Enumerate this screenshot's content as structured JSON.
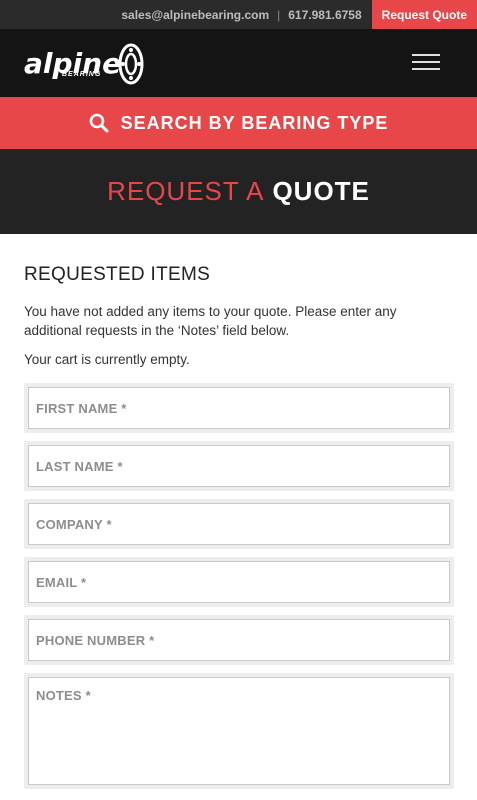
{
  "topbar": {
    "email": "sales@alpinebearing.com",
    "separator": "|",
    "phone": "617.981.6758",
    "request_quote_label": "Request Quote"
  },
  "header": {
    "logo_word": "alpine",
    "logo_sub": "BEARING",
    "menu_icon": "hamburger-icon"
  },
  "search_banner": {
    "icon": "search-icon",
    "label": "SEARCH BY BEARING TYPE"
  },
  "title": {
    "part1": "REQUEST A",
    "part2": "QUOTE"
  },
  "main": {
    "heading": "REQUESTED ITEMS",
    "notice": "You have not added any items to your quote. Please enter any additional requests in the ‘Notes’ field below.",
    "cart_status": "Your cart is currently empty."
  },
  "form": {
    "first_name_placeholder": "FIRST NAME *",
    "last_name_placeholder": "LAST NAME *",
    "company_placeholder": "COMPANY *",
    "email_placeholder": "EMAIL *",
    "phone_placeholder": "PHONE NUMBER *",
    "notes_placeholder": "NOTES *"
  },
  "colors": {
    "accent": "#e8474a",
    "topbar_bg": "#2b2b2b",
    "header_bg": "#141414",
    "title_bg": "#232323"
  }
}
